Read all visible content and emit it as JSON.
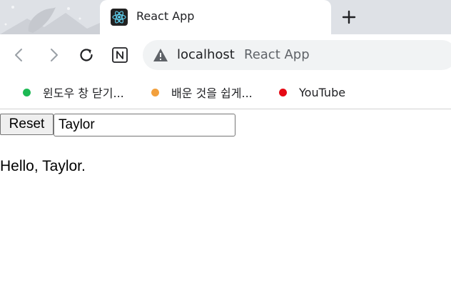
{
  "browser": {
    "tab": {
      "title": "React App",
      "favicon": "react-logo-icon"
    },
    "new_tab_icon": "plus-icon",
    "toolbar": {
      "back_icon": "back-arrow-icon",
      "forward_icon": "forward-arrow-icon",
      "reload_icon": "reload-icon",
      "extension_icon": "notion-icon"
    },
    "address_bar": {
      "security_icon": "warning-icon",
      "host": "localhost",
      "page_title": "React App"
    },
    "bookmarks": [
      {
        "label": "윈도우 창 닫기...",
        "color": "#1db954"
      },
      {
        "label": "배운 것을 쉽게...",
        "color": "#f2a03d"
      },
      {
        "label": "YouTube",
        "color": "#e50914"
      }
    ]
  },
  "page": {
    "reset_label": "Reset",
    "name_value": "Taylor",
    "greeting": "Hello, Taylor."
  },
  "colors": {
    "tabstrip_bg": "#dee1e6",
    "omnibox_bg": "#f1f3f4"
  }
}
